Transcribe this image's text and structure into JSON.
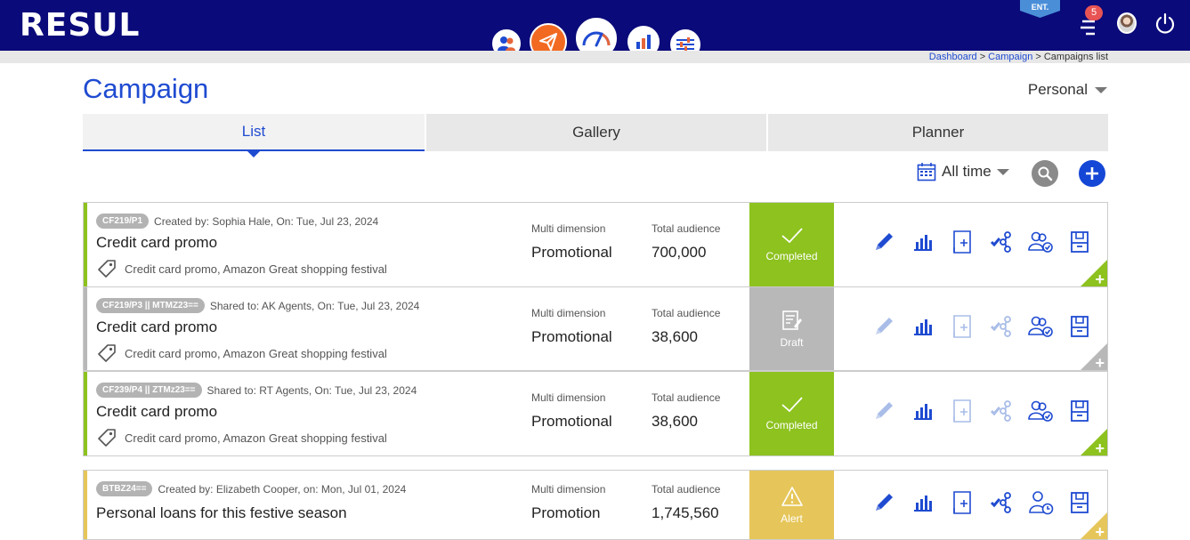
{
  "app": {
    "logo_text": "RESUL",
    "plan_badge": "ENT.",
    "notification_count": "5"
  },
  "colors": {
    "header": "#0a0a7a",
    "accent": "#1f4bd1",
    "completed": "#8dc21f",
    "draft": "#b8b8b8",
    "alert": "#e6c65a"
  },
  "nav": {
    "items": [
      "audience-icon",
      "campaign-send-icon",
      "dashboard-gauge-icon",
      "analytics-chart-icon",
      "preferences-sliders-icon"
    ]
  },
  "breadcrumb": {
    "items": [
      "Dashboard",
      "Campaign",
      "Campaigns list"
    ]
  },
  "page": {
    "title": "Campaign",
    "owner_filter": "Personal"
  },
  "tabs": [
    {
      "label": "List"
    },
    {
      "label": "Gallery"
    },
    {
      "label": "Planner"
    }
  ],
  "toolbar": {
    "time_filter": "All time"
  },
  "campaigns": [
    {
      "id": "CF219/P1",
      "meta": "Created by: Sophia Hale, On: Tue, Jul 23, 2024",
      "title": "Credit card promo",
      "tags": "Credit card promo, Amazon Great shopping festival",
      "dimension_label": "Multi dimension",
      "dimension": "Promotional",
      "audience_label": "Total audience",
      "audience": "700,000",
      "status": "Completed"
    },
    {
      "id": "CF219/P3 || MTMZ23==",
      "meta": "Shared to: AK Agents, On: Tue, Jul 23, 2024",
      "title": "Credit card promo",
      "tags": "Credit card promo, Amazon Great shopping festival",
      "dimension_label": "Multi dimension",
      "dimension": "Promotional",
      "audience_label": "Total audience",
      "audience": "38,600",
      "status": "Draft"
    },
    {
      "id": "CF239/P4 || ZTMz23==",
      "meta": "Shared to: RT Agents, On: Tue, Jul 23, 2024",
      "title": "Credit card promo",
      "tags": "Credit card promo, Amazon Great shopping festival",
      "dimension_label": "Multi dimension",
      "dimension": "Promotional",
      "audience_label": "Total audience",
      "audience": "38,600",
      "status": "Completed"
    },
    {
      "id": "BTBZ24==",
      "meta": "Created by: Elizabeth Cooper, on: Mon, Jul 01, 2024",
      "title": "Personal loans for this festive season",
      "tags": "",
      "dimension_label": "Multi dimension",
      "dimension": "Promotion",
      "audience_label": "Total audience",
      "audience": "1,745,560",
      "status": "Alert"
    }
  ],
  "row_actions": [
    "edit-icon",
    "report-icon",
    "duplicate-icon",
    "share-icon",
    "audience-share-icon",
    "archive-icon"
  ]
}
